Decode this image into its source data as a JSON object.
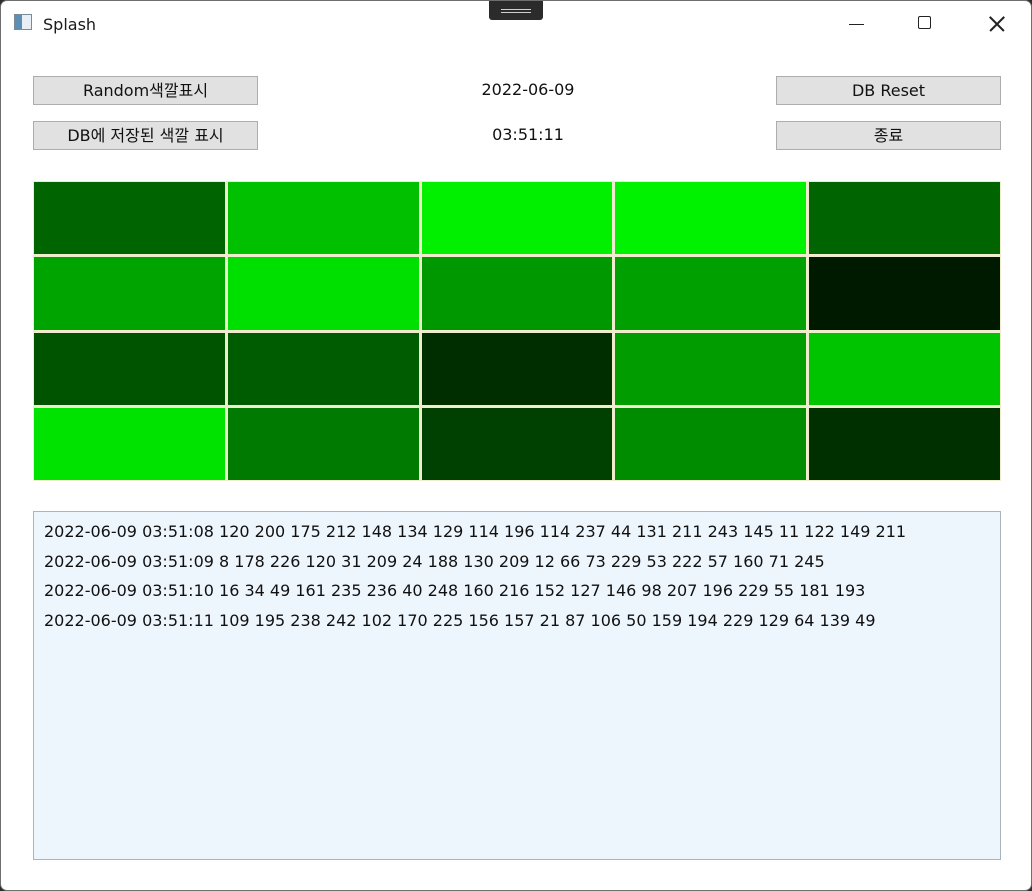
{
  "window": {
    "title": "Splash",
    "icon": "app-window-icon"
  },
  "controls": {
    "random_label": "Random색깔표시",
    "dbshow_label": "DB에 저장된 색깔 표시",
    "reset_label": "DB Reset",
    "exit_label": "종료",
    "date_text": "2022-06-09",
    "time_text": "03:51:11"
  },
  "color_grid": {
    "rows": 4,
    "cols": 5,
    "cells": [
      "#006400",
      "#00c000",
      "#00f000",
      "#00f200",
      "#006400",
      "#00a400",
      "#00e000",
      "#009800",
      "#00a000",
      "#001a00",
      "#005400",
      "#005c00",
      "#002e00",
      "#009c00",
      "#00c400",
      "#00e200",
      "#007a00",
      "#004000",
      "#008c00",
      "#003000"
    ]
  },
  "log": {
    "lines": [
      "2022-06-09 03:51:08 120 200 175 212 148 134 129 114 196 114 237 44 131 211 243 145 11 122 149 211",
      "2022-06-09 03:51:09 8 178 226 120 31 209 24 188 130 209 12 66 73 229 53 222 57 160 71 245",
      "2022-06-09 03:51:10 16 34 49 161 235 236 40 248 160 216 152 127 146 98 207 196 229 55 181 193",
      "2022-06-09 03:51:11 109 195 238 242 102 170 225 156 157 21 87 106 50 159 194 229 129 64 139 49"
    ]
  }
}
